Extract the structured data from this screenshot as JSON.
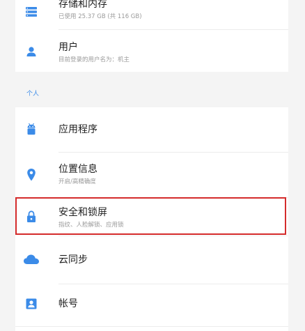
{
  "accent_color": "#3b8be8",
  "highlight_color": "#d42b2b",
  "top_group": [
    {
      "title": "存储和内存",
      "subtitle": "已使用 25.37 GB (共 116 GB)",
      "icon": "storage-icon"
    },
    {
      "title": "用户",
      "subtitle": "目前登录的用户名为：机主",
      "icon": "user-icon"
    }
  ],
  "section_personal": {
    "label": "个人",
    "items": [
      {
        "title": "应用程序",
        "subtitle": "",
        "icon": "android-icon"
      },
      {
        "title": "位置信息",
        "subtitle": "开启/高精确度",
        "icon": "location-pin-icon"
      },
      {
        "title": "安全和锁屏",
        "subtitle": "指纹、人脸解锁、应用锁",
        "icon": "lock-icon",
        "highlighted": true
      },
      {
        "title": "云同步",
        "subtitle": "",
        "icon": "cloud-icon"
      },
      {
        "title": "帐号",
        "subtitle": "",
        "icon": "account-card-icon"
      }
    ]
  }
}
